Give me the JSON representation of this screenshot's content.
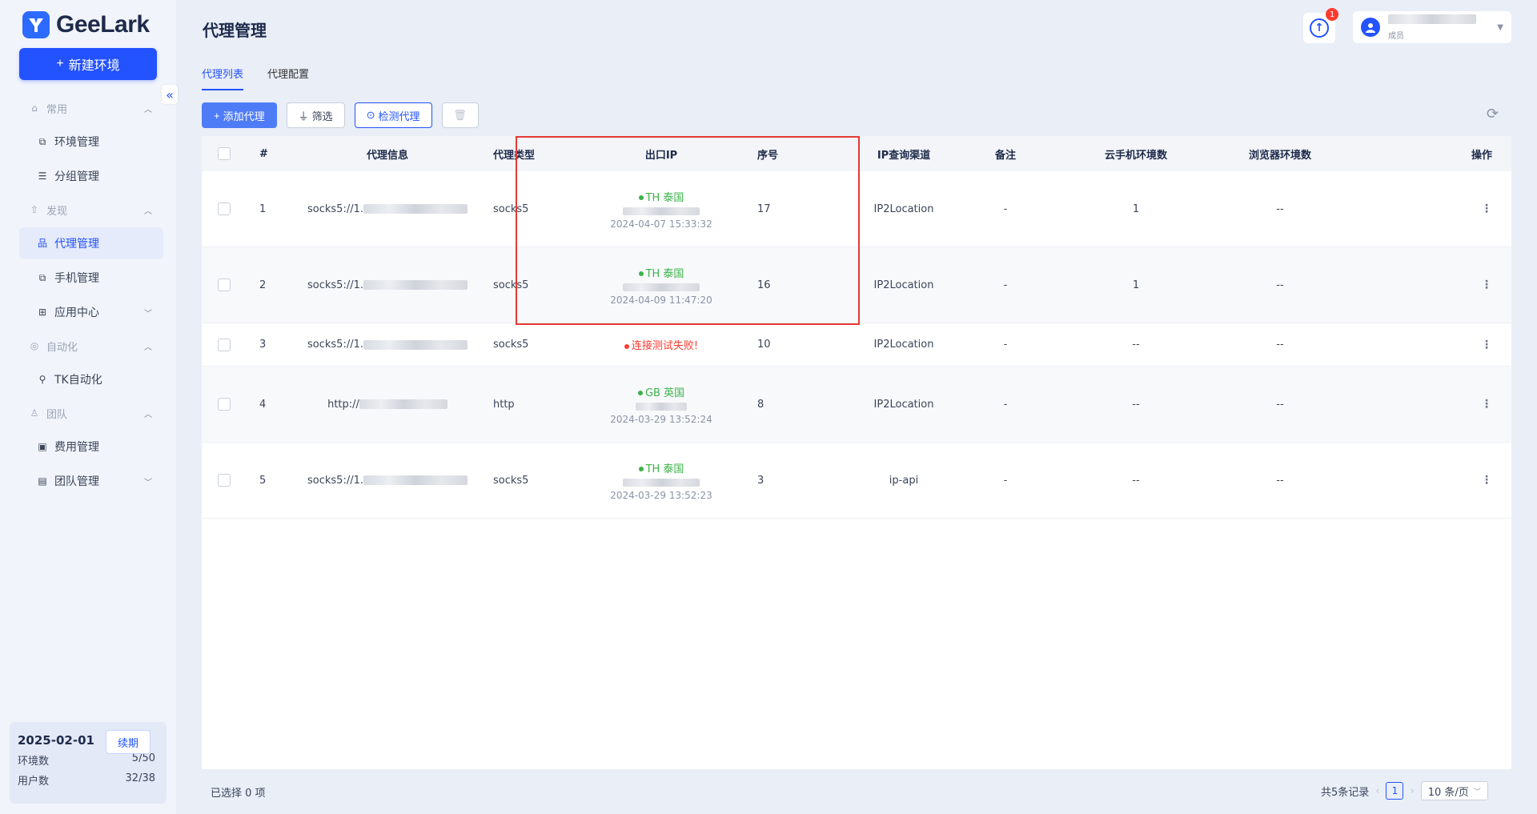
{
  "app": {
    "brand": "GeeLark",
    "new_env_label": "新建环境",
    "collapse_icon": "«"
  },
  "sidebar": {
    "sections": [
      {
        "label": "常用",
        "items": [
          {
            "label": "环境管理"
          },
          {
            "label": "分组管理"
          }
        ]
      },
      {
        "label": "发现",
        "items": [
          {
            "label": "代理管理",
            "active": true
          },
          {
            "label": "手机管理"
          },
          {
            "label": "应用中心",
            "expandable": true
          }
        ]
      },
      {
        "label": "自动化",
        "items": [
          {
            "label": "TK自动化"
          }
        ]
      },
      {
        "label": "团队",
        "items": [
          {
            "label": "费用管理"
          },
          {
            "label": "团队管理",
            "expandable": true
          }
        ]
      }
    ],
    "plan": {
      "date": "2025-02-01",
      "renew_label": "续期",
      "env_label": "环境数",
      "env_value": "5/50",
      "user_label": "用户数",
      "user_value": "32/38"
    }
  },
  "header": {
    "title": "代理管理",
    "upload_badge": "1",
    "user_role": "成员"
  },
  "tabs": [
    {
      "label": "代理列表",
      "active": true
    },
    {
      "label": "代理配置"
    }
  ],
  "toolbar": {
    "add_label": "添加代理",
    "filter_label": "筛选",
    "check_label": "检测代理"
  },
  "table": {
    "columns": [
      "#",
      "代理信息",
      "代理类型",
      "出口IP",
      "序号",
      "IP查询渠道",
      "备注",
      "云手机环境数",
      "浏览器环境数",
      "操作"
    ],
    "rows": [
      {
        "idx": "1",
        "info": "socks5://1.",
        "type": "socks5",
        "ip_status": "ok",
        "country": "TH 泰国",
        "time": "2024-04-07 15:33:32",
        "seq": "17",
        "channel": "IP2Location",
        "note": "-",
        "cloud": "1",
        "browser": "--"
      },
      {
        "idx": "2",
        "info": "socks5://1.",
        "type": "socks5",
        "ip_status": "ok",
        "country": "TH 泰国",
        "time": "2024-04-09 11:47:20",
        "seq": "16",
        "channel": "IP2Location",
        "note": "-",
        "cloud": "1",
        "browser": "--"
      },
      {
        "idx": "3",
        "info": "socks5://1.",
        "type": "socks5",
        "ip_status": "fail",
        "country": "连接测试失败!",
        "time": "",
        "seq": "10",
        "channel": "IP2Location",
        "note": "-",
        "cloud": "--",
        "browser": "--"
      },
      {
        "idx": "4",
        "info": "http://",
        "type": "http",
        "ip_status": "ok",
        "country": "GB 英国",
        "time": "2024-03-29 13:52:24",
        "seq": "8",
        "channel": "IP2Location",
        "note": "-",
        "cloud": "--",
        "browser": "--"
      },
      {
        "idx": "5",
        "info": "socks5://1.",
        "type": "socks5",
        "ip_status": "ok",
        "country": "TH 泰国",
        "time": "2024-03-29 13:52:23",
        "seq": "3",
        "channel": "ip-api",
        "note": "-",
        "cloud": "--",
        "browser": "--"
      }
    ]
  },
  "footer": {
    "selected": "已选择 0 项",
    "total": "共5条记录",
    "page": "1",
    "page_size": "10 条/页"
  },
  "colors": {
    "accent": "#2352ff",
    "ok": "#3bb34a",
    "fail": "#ff3b30",
    "highlight": "#e53935"
  }
}
